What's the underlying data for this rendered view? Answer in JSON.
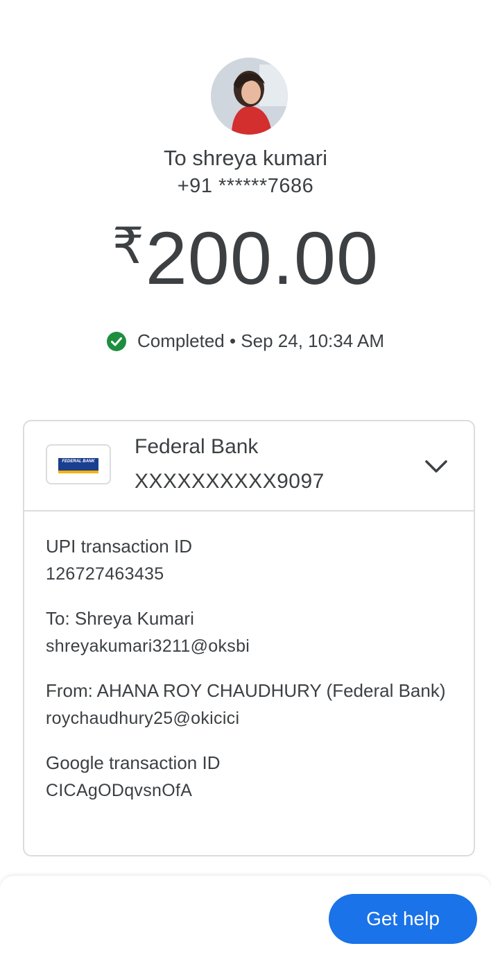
{
  "recipient": {
    "name_line": "To shreya kumari",
    "phone": "+91 ******7686"
  },
  "payment": {
    "currency_symbol": "₹",
    "amount": "200.00",
    "status": "Completed • Sep 24, 10:34 AM",
    "status_color": "#1e8e3e"
  },
  "bank": {
    "logo_text": "FEDERAL BANK",
    "name": "Federal Bank",
    "account": "XXXXXXXXXX9097"
  },
  "details": {
    "upi_label": "UPI transaction ID",
    "upi_value": "126727463435",
    "to_label": "To: Shreya  Kumari",
    "to_value": "shreyakumari3211@oksbi",
    "from_label": "From: AHANA ROY CHAUDHURY (Federal Bank)",
    "from_value": "roychaudhury25@okicici",
    "google_label": "Google transaction ID",
    "google_value": "CICAgODqvsnOfA"
  },
  "actions": {
    "help_label": "Get help",
    "accent": "#1a73e8"
  }
}
